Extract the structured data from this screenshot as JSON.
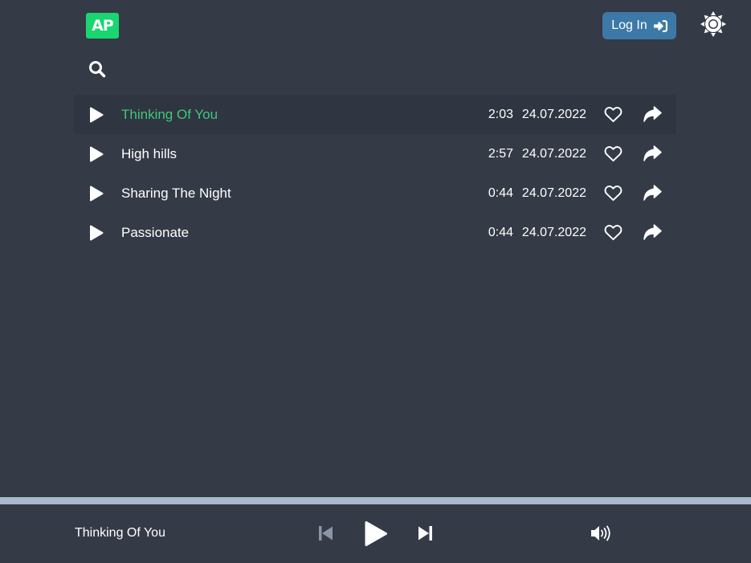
{
  "header": {
    "logo_text": "AP",
    "login_label": "Log In",
    "brand_color": "#19d671",
    "login_color": "#3d79a7"
  },
  "icons": {
    "search": "search-icon",
    "theme": "sun-icon",
    "play": "play-icon",
    "like": "heart-icon",
    "share": "share-icon",
    "prev": "skip-back-icon",
    "next": "skip-forward-icon",
    "volume": "volume-icon"
  },
  "tracks": [
    {
      "title": "Thinking Of You",
      "duration": "2:03",
      "date": "24.07.2022",
      "active": true
    },
    {
      "title": "High hills",
      "duration": "2:57",
      "date": "24.07.2022",
      "active": false
    },
    {
      "title": "Sharing The Night",
      "duration": "0:44",
      "date": "24.07.2022",
      "active": false
    },
    {
      "title": "Passionate",
      "duration": "0:44",
      "date": "24.07.2022",
      "active": false
    }
  ],
  "player": {
    "now_playing": "Thinking Of You",
    "progress": 0,
    "active_color": "#3fc97a"
  }
}
